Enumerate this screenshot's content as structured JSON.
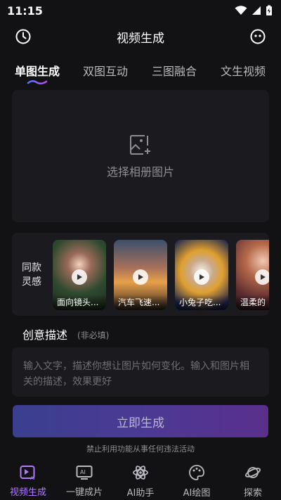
{
  "status_bar": {
    "time": "11:15"
  },
  "header": {
    "title": "视频生成"
  },
  "tabs": [
    {
      "label": "单图生成",
      "active": true
    },
    {
      "label": "双图互动",
      "active": false
    },
    {
      "label": "三图融合",
      "active": false
    },
    {
      "label": "文生视频",
      "active": false
    }
  ],
  "upload": {
    "label": "选择相册图片"
  },
  "inspiration": {
    "label_line1": "同款",
    "label_line2": "灵感",
    "items": [
      {
        "caption": "面向镜头..."
      },
      {
        "caption": "汽车飞速..."
      },
      {
        "caption": "小兔子吃..."
      },
      {
        "caption": "温柔的"
      }
    ]
  },
  "description": {
    "title": "创意描述",
    "optional": "(非必填)",
    "placeholder": "输入文字，描述你想让图片如何变化。输入和图片相关的描述，效果更好"
  },
  "generate_button": {
    "label": "立即生成"
  },
  "notice": "禁止利用功能从事任何违法活动",
  "bottom_nav": [
    {
      "label": "视频生成",
      "icon": "video-ai-icon",
      "active": true
    },
    {
      "label": "一键成片",
      "icon": "ai-clip-icon",
      "active": false
    },
    {
      "label": "AI助手",
      "icon": "atom-icon",
      "active": false
    },
    {
      "label": "AI绘图",
      "icon": "palette-icon",
      "active": false
    },
    {
      "label": "探索",
      "icon": "planet-icon",
      "active": false
    }
  ],
  "colors": {
    "accent": "#b07bff",
    "background": "#121214",
    "card": "#1b1b1f"
  }
}
